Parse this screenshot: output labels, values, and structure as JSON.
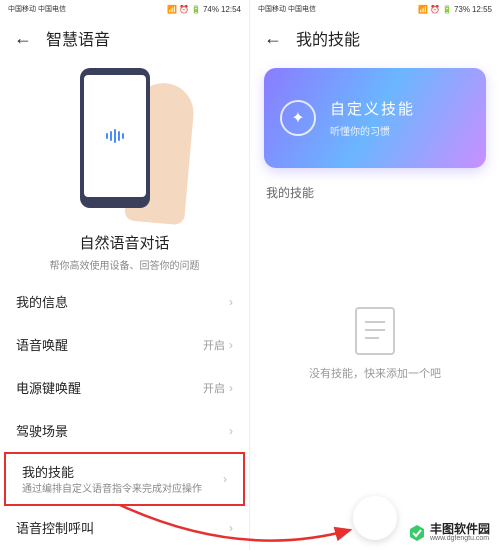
{
  "left": {
    "status": {
      "carrier": "中国移动 中国电信",
      "battery": "74%",
      "time": "12:54"
    },
    "header": {
      "title": "智慧语音"
    },
    "hero": {
      "title": "自然语音对话",
      "desc": "帮你高效使用设备、回答你的问题"
    },
    "items": [
      {
        "label": "我的信息",
        "value": "",
        "desc": ""
      },
      {
        "label": "语音唤醒",
        "value": "开启",
        "desc": ""
      },
      {
        "label": "电源键唤醒",
        "value": "开启",
        "desc": ""
      },
      {
        "label": "驾驶场景",
        "value": "",
        "desc": ""
      },
      {
        "label": "我的技能",
        "value": "",
        "desc": "通过编排自定义语音指令来完成对应操作"
      },
      {
        "label": "语音控制呼叫",
        "value": "",
        "desc": ""
      }
    ]
  },
  "right": {
    "status": {
      "carrier": "中国移动 中国电信",
      "battery": "73%",
      "time": "12:55"
    },
    "header": {
      "title": "我的技能"
    },
    "card": {
      "title": "自定义技能",
      "sub": "听懂你的习惯"
    },
    "section": "我的技能",
    "empty": "没有技能，快来添加一个吧"
  },
  "watermark": {
    "name": "丰图软件园",
    "url": "www.dgfengtu.com"
  }
}
